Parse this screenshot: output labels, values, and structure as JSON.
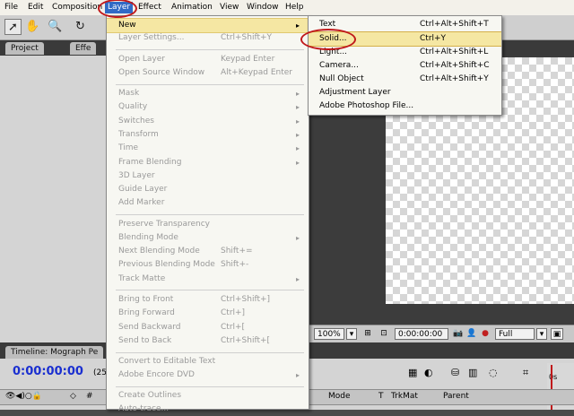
{
  "menubar": {
    "items": [
      "File",
      "Edit",
      "Composition",
      "Layer",
      "Effect",
      "Animation",
      "View",
      "Window",
      "Help"
    ],
    "active": "Layer"
  },
  "toolbar": {
    "tools": [
      "selection-tool-icon",
      "hand-tool-icon",
      "zoom-tool-icon",
      "rotate-tool-icon"
    ]
  },
  "panels": {
    "project_tab": "Project",
    "effects_tab": "Effe"
  },
  "viewer": {
    "zoom": "100%",
    "timecode": "0:00:00:00",
    "resolution": "Full"
  },
  "timeline": {
    "tab_label": "Timeline: Mograph Pe",
    "current_time": "0:00:00:00",
    "fps_fragment": "(25",
    "col_hash": "#",
    "col_mode": "Mode",
    "col_t": "T",
    "col_trkmat": "TrkMat",
    "col_parent": "Parent",
    "ruler_start": "0s"
  },
  "layer_menu": {
    "items": [
      {
        "label": "New",
        "shortcut": "",
        "arrow": "▸",
        "enabled": true
      },
      {
        "label": "Layer Settings...",
        "shortcut": "Ctrl+Shift+Y",
        "arrow": "",
        "enabled": false
      },
      {
        "label": "Open Layer",
        "shortcut": "Keypad Enter",
        "arrow": "",
        "enabled": false
      },
      {
        "label": "Open Source Window",
        "shortcut": "Alt+Keypad Enter",
        "arrow": "",
        "enabled": false
      },
      {
        "label": "Mask",
        "shortcut": "",
        "arrow": "▸",
        "enabled": false
      },
      {
        "label": "Quality",
        "shortcut": "",
        "arrow": "▸",
        "enabled": false
      },
      {
        "label": "Switches",
        "shortcut": "",
        "arrow": "▸",
        "enabled": false
      },
      {
        "label": "Transform",
        "shortcut": "",
        "arrow": "▸",
        "enabled": false
      },
      {
        "label": "Time",
        "shortcut": "",
        "arrow": "▸",
        "enabled": false
      },
      {
        "label": "Frame Blending",
        "shortcut": "",
        "arrow": "▸",
        "enabled": false
      },
      {
        "label": "3D Layer",
        "shortcut": "",
        "arrow": "",
        "enabled": false
      },
      {
        "label": "Guide Layer",
        "shortcut": "",
        "arrow": "",
        "enabled": false
      },
      {
        "label": "Add Marker",
        "shortcut": "",
        "arrow": "",
        "enabled": false
      },
      {
        "label": "Preserve Transparency",
        "shortcut": "",
        "arrow": "",
        "enabled": false
      },
      {
        "label": "Blending Mode",
        "shortcut": "",
        "arrow": "▸",
        "enabled": false
      },
      {
        "label": "Next Blending Mode",
        "shortcut": "Shift+=",
        "arrow": "",
        "enabled": false
      },
      {
        "label": "Previous Blending Mode",
        "shortcut": "Shift+-",
        "arrow": "",
        "enabled": false
      },
      {
        "label": "Track Matte",
        "shortcut": "",
        "arrow": "▸",
        "enabled": false
      },
      {
        "label": "Bring to Front",
        "shortcut": "Ctrl+Shift+]",
        "arrow": "",
        "enabled": false
      },
      {
        "label": "Bring Forward",
        "shortcut": "Ctrl+]",
        "arrow": "",
        "enabled": false
      },
      {
        "label": "Send Backward",
        "shortcut": "Ctrl+[",
        "arrow": "",
        "enabled": false
      },
      {
        "label": "Send to Back",
        "shortcut": "Ctrl+Shift+[",
        "arrow": "",
        "enabled": false
      },
      {
        "label": "Convert to Editable Text",
        "shortcut": "",
        "arrow": "",
        "enabled": false
      },
      {
        "label": "Adobe Encore DVD",
        "shortcut": "",
        "arrow": "▸",
        "enabled": false
      },
      {
        "label": "Create Outlines",
        "shortcut": "",
        "arrow": "",
        "enabled": false
      },
      {
        "label": "Auto-trace...",
        "shortcut": "",
        "arrow": "",
        "enabled": false
      }
    ]
  },
  "new_submenu": {
    "items": [
      {
        "label": "Text",
        "shortcut": "Ctrl+Alt+Shift+T"
      },
      {
        "label": "Solid...",
        "shortcut": "Ctrl+Y"
      },
      {
        "label": "Light...",
        "shortcut": "Ctrl+Alt+Shift+L"
      },
      {
        "label": "Camera...",
        "shortcut": "Ctrl+Alt+Shift+C"
      },
      {
        "label": "Null Object",
        "shortcut": "Ctrl+Alt+Shift+Y"
      },
      {
        "label": "Adjustment Layer",
        "shortcut": ""
      },
      {
        "label": "Adobe Photoshop File...",
        "shortcut": ""
      }
    ],
    "highlighted": "Solid..."
  },
  "colors": {
    "menu_highlight": "#f5e7a3",
    "annotation_ring": "#c0191b",
    "timecode_blue": "#1a2fd0"
  }
}
